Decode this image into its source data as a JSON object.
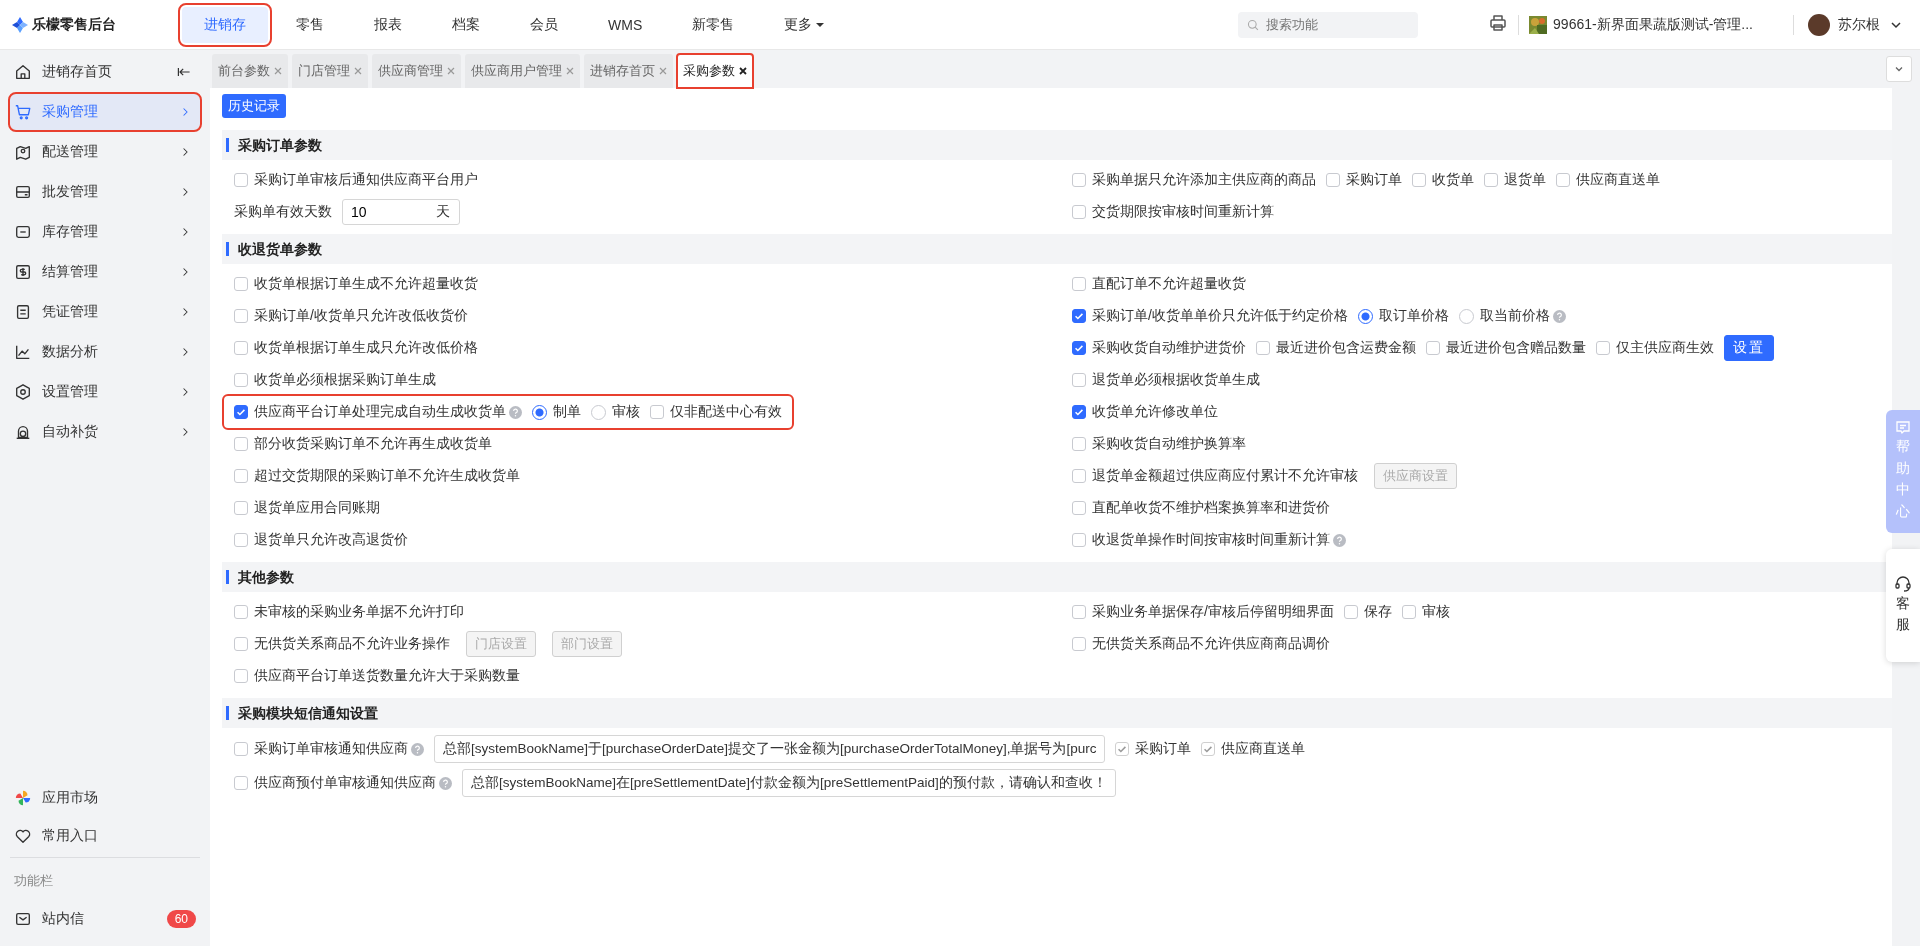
{
  "brand": "乐檬零售后台",
  "top_nav": [
    {
      "label": "进销存",
      "selected": true,
      "highlighted": true
    },
    {
      "label": "零售",
      "selected": false,
      "highlighted": false
    },
    {
      "label": "报表",
      "selected": false,
      "highlighted": false
    },
    {
      "label": "档案",
      "selected": false,
      "highlighted": false
    },
    {
      "label": "会员",
      "selected": false,
      "highlighted": false
    },
    {
      "label": "WMS",
      "selected": false,
      "highlighted": false
    },
    {
      "label": "新零售",
      "selected": false,
      "highlighted": false
    },
    {
      "label": "更多",
      "selected": false,
      "highlighted": false,
      "dropdown": true
    }
  ],
  "search": {
    "placeholder": "搜索功能"
  },
  "store": "99661-新界面果蔬版测试-管理...",
  "user": "苏尔根",
  "sidebar": {
    "items": [
      {
        "label": "进销存首页",
        "selected": false,
        "highlighted": false,
        "arrow": false
      },
      {
        "label": "采购管理",
        "selected": true,
        "highlighted": true,
        "arrow": true
      },
      {
        "label": "配送管理",
        "selected": false,
        "highlighted": false,
        "arrow": true
      },
      {
        "label": "批发管理",
        "selected": false,
        "highlighted": false,
        "arrow": true
      },
      {
        "label": "库存管理",
        "selected": false,
        "highlighted": false,
        "arrow": true
      },
      {
        "label": "结算管理",
        "selected": false,
        "highlighted": false,
        "arrow": true
      },
      {
        "label": "凭证管理",
        "selected": false,
        "highlighted": false,
        "arrow": true
      },
      {
        "label": "数据分析",
        "selected": false,
        "highlighted": false,
        "arrow": true
      },
      {
        "label": "设置管理",
        "selected": false,
        "highlighted": false,
        "arrow": true
      },
      {
        "label": "自动补货",
        "selected": false,
        "highlighted": false,
        "arrow": true
      }
    ],
    "bottom_items": [
      {
        "label": "应用市场"
      },
      {
        "label": "常用入口"
      }
    ],
    "section_label": "功能栏",
    "inbox": {
      "label": "站内信",
      "badge": "60"
    }
  },
  "tabs": [
    {
      "label": "前台参数",
      "selected": false,
      "highlighted": false
    },
    {
      "label": "门店管理",
      "selected": false,
      "highlighted": false
    },
    {
      "label": "供应商管理",
      "selected": false,
      "highlighted": false
    },
    {
      "label": "供应商用户管理",
      "selected": false,
      "highlighted": false
    },
    {
      "label": "进销存首页",
      "selected": false,
      "highlighted": false
    },
    {
      "label": "采购参数",
      "selected": true,
      "highlighted": true
    }
  ],
  "history_button": "历史记录",
  "sections": [
    {
      "title": "采购订单参数",
      "left": [
        {
          "highlighted": false,
          "parts": [
            {
              "kind": "checkbox",
              "label": "采购订单审核后通知供应商平台用户",
              "checked": false,
              "help": false
            }
          ]
        },
        {
          "highlighted": false,
          "parts": [
            {
              "kind": "label",
              "label": "采购单有效天数"
            },
            {
              "kind": "number_field",
              "value": "10",
              "unit": "天"
            }
          ]
        }
      ],
      "right": [
        {
          "highlighted": false,
          "parts": [
            {
              "kind": "checkbox",
              "label": "采购单据只允许添加主供应商的商品",
              "checked": false,
              "help": false
            },
            {
              "kind": "checkbox",
              "label": "采购订单",
              "checked": false,
              "help": false
            },
            {
              "kind": "checkbox",
              "label": "收货单",
              "checked": false,
              "help": false
            },
            {
              "kind": "checkbox",
              "label": "退货单",
              "checked": false,
              "help": false
            },
            {
              "kind": "checkbox",
              "label": "供应商直送单",
              "checked": false,
              "help": false
            }
          ]
        },
        {
          "highlighted": false,
          "parts": [
            {
              "kind": "checkbox",
              "label": "交货期限按审核时间重新计算",
              "checked": false,
              "help": false
            }
          ]
        }
      ]
    },
    {
      "title": "收退货单参数",
      "left": [
        {
          "highlighted": false,
          "parts": [
            {
              "kind": "checkbox",
              "label": "收货单根据订单生成不允许超量收货",
              "checked": false,
              "help": false
            }
          ]
        },
        {
          "highlighted": false,
          "parts": [
            {
              "kind": "checkbox",
              "label": "采购订单/收货单只允许改低收货价",
              "checked": false,
              "help": false
            }
          ]
        },
        {
          "highlighted": false,
          "parts": [
            {
              "kind": "checkbox",
              "label": "收货单根据订单生成只允许改低价格",
              "checked": false,
              "help": false
            }
          ]
        },
        {
          "highlighted": false,
          "parts": [
            {
              "kind": "checkbox",
              "label": "收货单必须根据采购订单生成",
              "checked": false,
              "help": false
            }
          ]
        },
        {
          "highlighted": true,
          "parts": [
            {
              "kind": "checkbox",
              "label": "供应商平台订单处理完成自动生成收货单",
              "checked": true,
              "help": true
            },
            {
              "kind": "radio",
              "label": "制单",
              "selected": true,
              "help": false
            },
            {
              "kind": "radio",
              "label": "审核",
              "selected": false,
              "help": false
            },
            {
              "kind": "checkbox",
              "label": "仅非配送中心有效",
              "checked": false,
              "help": false
            }
          ]
        },
        {
          "highlighted": false,
          "parts": [
            {
              "kind": "checkbox",
              "label": "部分收货采购订单不允许再生成收货单",
              "checked": false,
              "help": false
            }
          ]
        },
        {
          "highlighted": false,
          "parts": [
            {
              "kind": "checkbox",
              "label": "超过交货期限的采购订单不允许生成收货单",
              "checked": false,
              "help": false
            }
          ]
        },
        {
          "highlighted": false,
          "parts": [
            {
              "kind": "checkbox",
              "label": "退货单应用合同账期",
              "checked": false,
              "help": false
            }
          ]
        },
        {
          "highlighted": false,
          "parts": [
            {
              "kind": "checkbox",
              "label": "退货单只允许改高退货价",
              "checked": false,
              "help": false
            }
          ]
        }
      ],
      "right": [
        {
          "highlighted": false,
          "parts": [
            {
              "kind": "checkbox",
              "label": "直配订单不允许超量收货",
              "checked": false,
              "help": false
            }
          ]
        },
        {
          "highlighted": false,
          "parts": [
            {
              "kind": "checkbox",
              "label": "采购订单/收货单单价只允许低于约定价格",
              "checked": true,
              "help": false
            },
            {
              "kind": "radio",
              "label": "取订单价格",
              "selected": true,
              "help": false
            },
            {
              "kind": "radio",
              "label": "取当前价格",
              "selected": false,
              "help": true
            }
          ]
        },
        {
          "highlighted": false,
          "parts": [
            {
              "kind": "checkbox",
              "label": "采购收货自动维护进货价",
              "checked": true,
              "help": false
            },
            {
              "kind": "checkbox",
              "label": "最近进价包含运费金额",
              "checked": false,
              "help": false
            },
            {
              "kind": "checkbox",
              "label": "最近进价包含赠品数量",
              "checked": false,
              "help": false
            },
            {
              "kind": "checkbox",
              "label": "仅主供应商生效",
              "checked": false,
              "help": false
            },
            {
              "kind": "button",
              "label": "设置",
              "disabled": false
            }
          ]
        },
        {
          "highlighted": false,
          "parts": [
            {
              "kind": "checkbox",
              "label": "退货单必须根据收货单生成",
              "checked": false,
              "help": false
            }
          ]
        },
        {
          "highlighted": false,
          "parts": [
            {
              "kind": "checkbox",
              "label": "收货单允许修改单位",
              "checked": true,
              "help": false
            }
          ]
        },
        {
          "highlighted": false,
          "parts": [
            {
              "kind": "checkbox",
              "label": "采购收货自动维护换算率",
              "checked": false,
              "help": false
            }
          ]
        },
        {
          "highlighted": false,
          "parts": [
            {
              "kind": "checkbox",
              "label": "退货单金额超过供应商应付累计不允许审核",
              "checked": false,
              "help": false
            },
            {
              "kind": "button",
              "label": "供应商设置",
              "disabled": true
            }
          ]
        },
        {
          "highlighted": false,
          "parts": [
            {
              "kind": "checkbox",
              "label": "直配单收货不维护档案换算率和进货价",
              "checked": false,
              "help": false
            }
          ]
        },
        {
          "highlighted": false,
          "parts": [
            {
              "kind": "checkbox",
              "label": "收退货单操作时间按审核时间重新计算",
              "checked": false,
              "help": true
            }
          ]
        }
      ]
    },
    {
      "title": "其他参数",
      "left": [
        {
          "highlighted": false,
          "parts": [
            {
              "kind": "checkbox",
              "label": "未审核的采购业务单据不允许打印",
              "checked": false,
              "help": false
            }
          ]
        },
        {
          "highlighted": false,
          "parts": [
            {
              "kind": "checkbox",
              "label": "无供货关系商品不允许业务操作",
              "checked": false,
              "help": false
            },
            {
              "kind": "button",
              "label": "门店设置",
              "disabled": true
            },
            {
              "kind": "button",
              "label": "部门设置",
              "disabled": true
            }
          ]
        },
        {
          "highlighted": false,
          "parts": [
            {
              "kind": "checkbox",
              "label": "供应商平台订单送货数量允许大于采购数量",
              "checked": false,
              "help": false
            }
          ]
        }
      ],
      "right": [
        {
          "highlighted": false,
          "parts": [
            {
              "kind": "checkbox",
              "label": "采购业务单据保存/审核后停留明细界面",
              "checked": false,
              "help": false
            },
            {
              "kind": "checkbox",
              "label": "保存",
              "checked": false,
              "help": false
            },
            {
              "kind": "checkbox",
              "label": "审核",
              "checked": false,
              "help": false
            }
          ]
        },
        {
          "highlighted": false,
          "parts": [
            {
              "kind": "checkbox",
              "label": "无供货关系商品不允许供应商商品调价",
              "checked": false,
              "help": false
            }
          ]
        }
      ]
    },
    {
      "title": "采购模块短信通知设置",
      "rows": [
        {
          "highlighted": false,
          "parts": [
            {
              "kind": "checkbox",
              "label": "采购订单审核通知供应商",
              "checked": false,
              "help": true
            },
            {
              "kind": "text_field",
              "value": "总部[systemBookName]于[purchaseOrderDate]提交了一张金额为[purchaseOrderTotalMoney],单据号为[purc"
            },
            {
              "kind": "tick",
              "label": "采购订单",
              "checked": true
            },
            {
              "kind": "tick",
              "label": "供应商直送单",
              "checked": true
            }
          ]
        },
        {
          "highlighted": false,
          "parts": [
            {
              "kind": "checkbox",
              "label": "供应商预付单审核通知供应商",
              "checked": false,
              "help": true
            },
            {
              "kind": "text_field",
              "value": "总部[systemBookName]在[preSettlementDate]付款金额为[preSettlementPaid]的预付款，请确认和查收！"
            }
          ]
        }
      ]
    }
  ],
  "float": {
    "help_center": "帮助中心",
    "service": "客服"
  }
}
